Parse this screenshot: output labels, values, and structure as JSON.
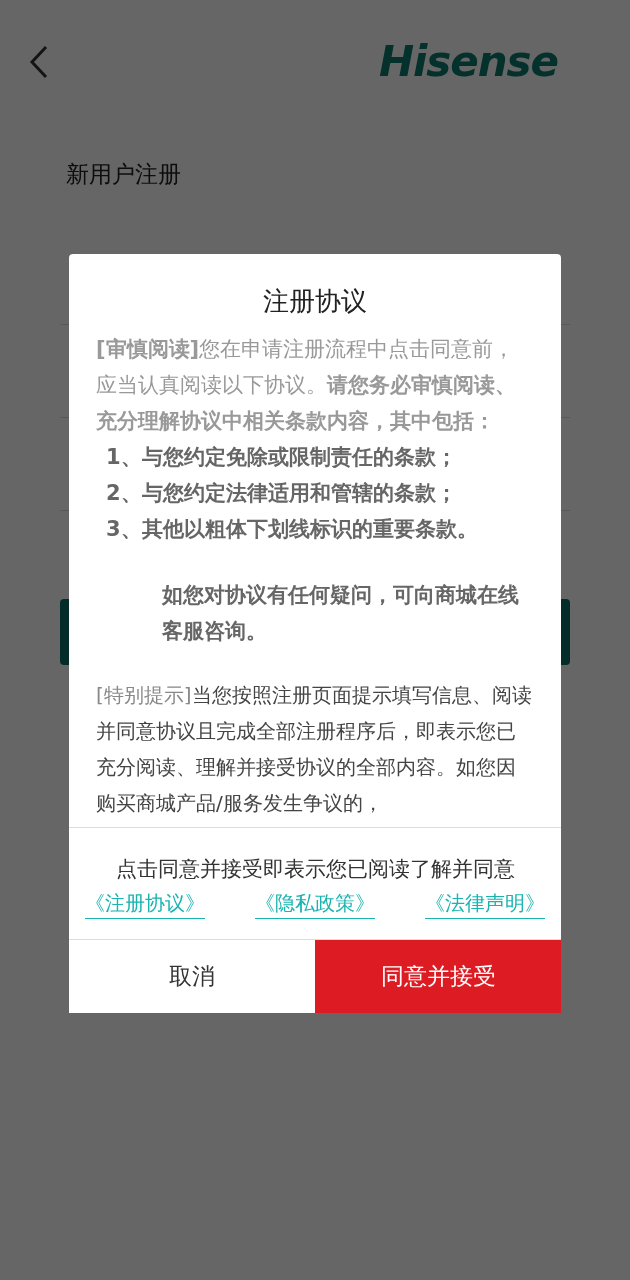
{
  "header": {
    "logo": "Hisense"
  },
  "page": {
    "title": "新用户注册",
    "submit": {
      "kind": "primary"
    }
  },
  "dialog": {
    "title": "注册协议",
    "intro": "**[审慎阅读]**您在申请注册流程中点击同意前，应当认真阅读以下协议。**请您务必审慎阅读、充分理解协议中相关条款内容，其中包括：**",
    "items": [
      "1、与您约定免除或限制责任的条款；",
      "2、与您约定法律适用和管辖的条款；",
      "3、其他以粗体下划线标识的重要条款。"
    ],
    "note": "如您对协议有任何疑问，可向商城在线客服咨询。",
    "notice": {
      "lead": "[特别提示]",
      "text": "当您按照注册页面提示填写信息、阅读并同意协议且完成全部注册程序后，即表示您已充分阅读、理解并接受协议的全部内容。如您因购买商城产品/服务发生争议的，"
    },
    "consent": "点击同意并接受即表示您已阅读了解并同意",
    "links": [
      "《注册协议》",
      "《隐私政策》",
      "《法律声明》"
    ],
    "buttons": [
      {
        "label": "取消",
        "kind": "cancel"
      },
      {
        "label": "同意并接受",
        "kind": "confirm"
      }
    ]
  }
}
